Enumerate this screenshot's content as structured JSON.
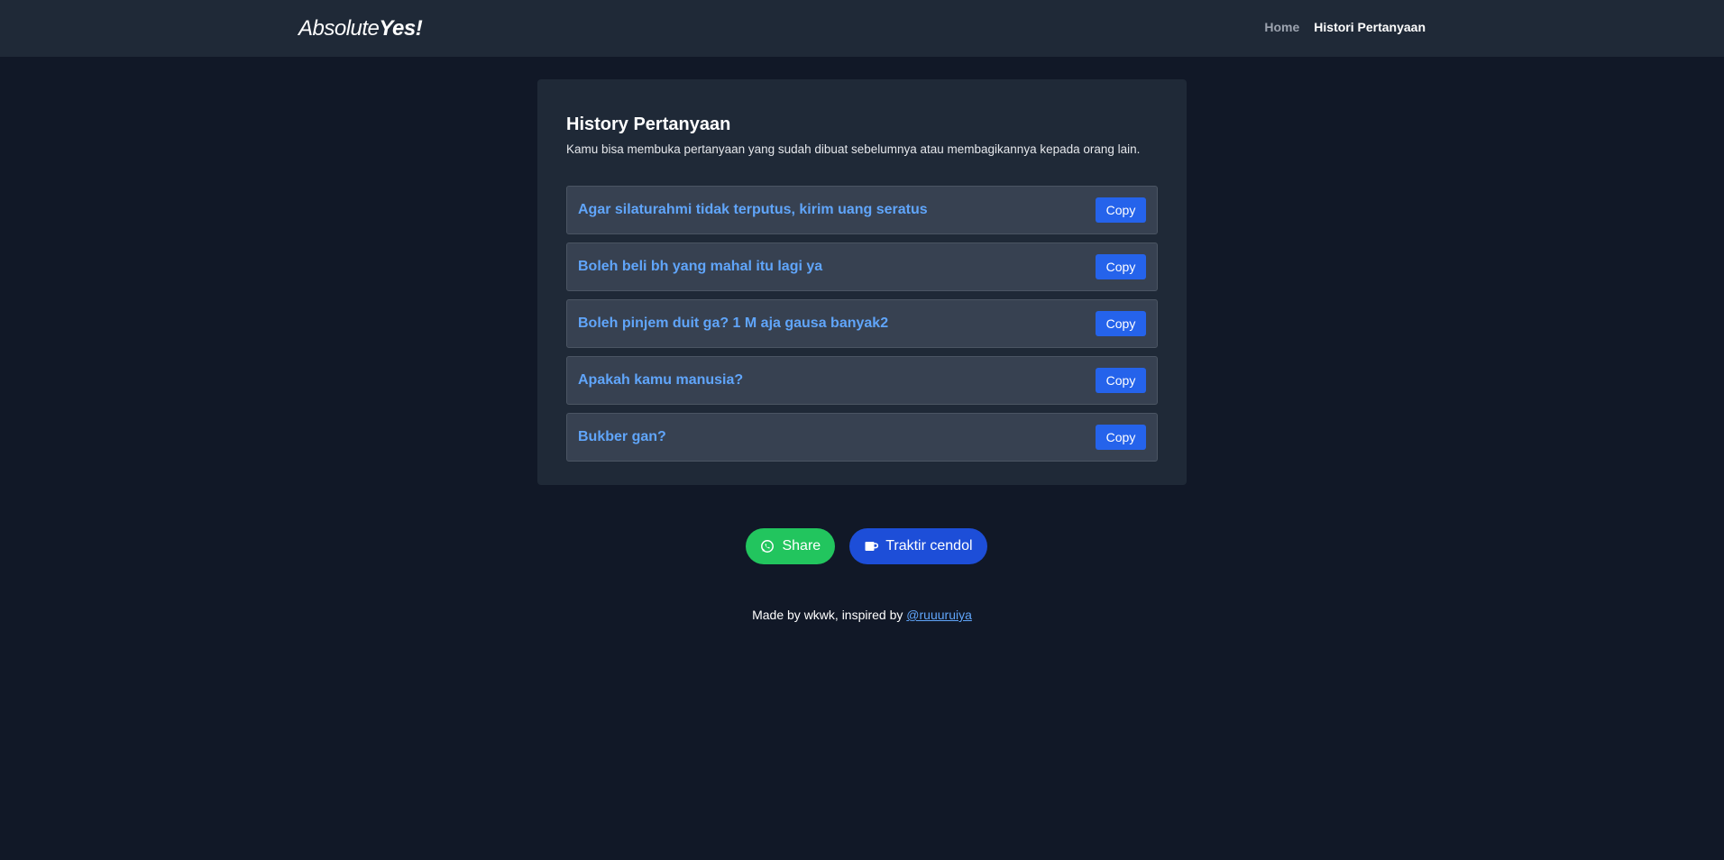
{
  "navbar": {
    "brand_light": "Absolute",
    "brand_bold": "Yes!",
    "links": [
      {
        "label": "Home",
        "active": false
      },
      {
        "label": "Histori Pertanyaan",
        "active": true
      }
    ]
  },
  "history": {
    "title": "History Pertanyaan",
    "description": "Kamu bisa membuka pertanyaan yang sudah dibuat sebelumnya atau membagikannya kepada orang lain.",
    "items": [
      {
        "question": "Agar silaturahmi tidak terputus, kirim uang seratus",
        "copy_label": "Copy"
      },
      {
        "question": "Boleh beli bh yang mahal itu lagi ya",
        "copy_label": "Copy"
      },
      {
        "question": "Boleh pinjem duit ga? 1 M aja gausa banyak2",
        "copy_label": "Copy"
      },
      {
        "question": "Apakah kamu manusia?",
        "copy_label": "Copy"
      },
      {
        "question": "Bukber gan?",
        "copy_label": "Copy"
      }
    ]
  },
  "actions": {
    "share_label": "Share",
    "share_icon": "whatsapp-icon",
    "cendol_label": "Traktir cendol",
    "cendol_icon": "coffee-cup-icon"
  },
  "footer": {
    "prefix": "Made by wkwk, inspired by ",
    "link_text": "@ruuuruiya"
  },
  "colors": {
    "background": "#111827",
    "surface": "#1f2937",
    "item_bg": "#374151",
    "link_blue": "#60a5fa",
    "button_blue": "#2563eb",
    "share_green": "#22c55e",
    "cendol_blue": "#1d4ed8"
  }
}
